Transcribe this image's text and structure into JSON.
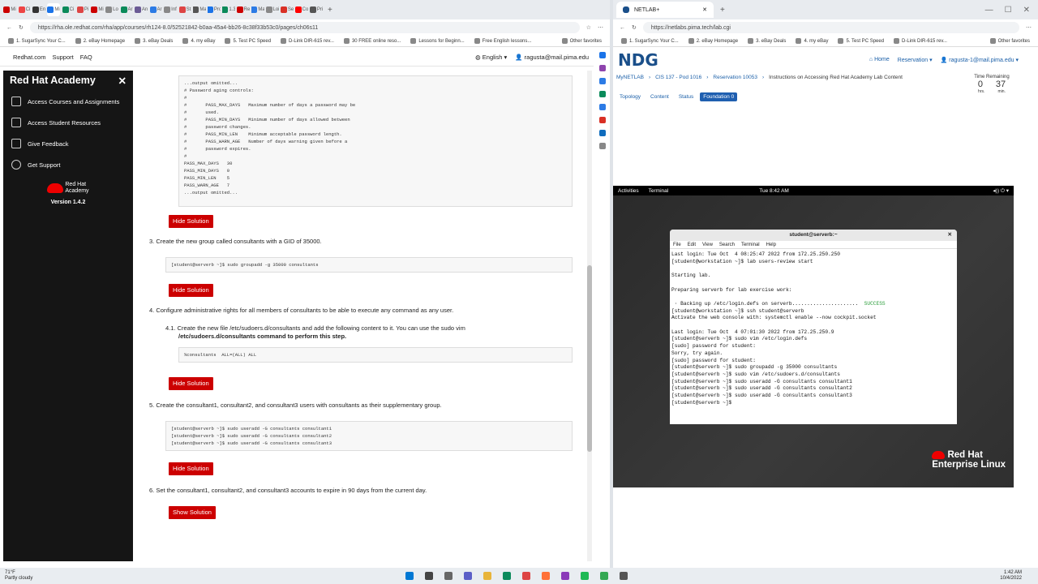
{
  "left_browser": {
    "tabs": [
      "Mi",
      "Ci",
      "En",
      "Mi",
      "Ci",
      "Pi",
      "Mi",
      "Lo",
      "Ar",
      "An",
      "Ar",
      "Inf",
      "St",
      "Ma",
      "Pro",
      "1.3",
      "Re",
      "Ma",
      "Loi",
      "Se",
      "Co",
      "Pri"
    ],
    "url": "https://rha.ole.redhat.com/rha/app/courses/rh124-8.0/52521842-b0aa-45a4-bb26-8c38f33b53c0/pages/ch06s11",
    "bookmarks": [
      "1. SugarSync Your C...",
      "2. eBay Homepage",
      "3. eBay Deals",
      "4. my eBay",
      "5. Test PC Speed",
      "D-Link DIR-615 rev...",
      "30 FREE online reso...",
      "Lessons for Beginn...",
      "Free English lessons...",
      "Other favorites"
    ],
    "topnav": {
      "links": [
        "Redhat.com",
        "Support",
        "FAQ"
      ],
      "language": "English",
      "user": "ragusta@mail.pima.edu"
    },
    "sidebar": {
      "title": "Red Hat Academy",
      "items": [
        "Access Courses and Assignments",
        "Access Student Resources",
        "Give Feedback",
        "Get Support"
      ],
      "logo_line1": "Red Hat",
      "logo_line2": "Academy",
      "version": "Version 1.4.2"
    },
    "content": {
      "code1": "...output omitted...\n# Password aging controls:\n#\n#       PASS_MAX_DAYS   Maximum number of days a password may be\n#       used.\n#       PASS_MIN_DAYS   Minimum number of days allowed between\n#       password changes.\n#       PASS_MIN_LEN    Minimum acceptable password length.\n#       PASS_WARN_AGE   Number of days warning given before a\n#       password expires.\n#\nPASS_MAX_DAYS   30\nPASS_MIN_DAYS   0\nPASS_MIN_LEN    5\nPASS_WARN_AGE   7\n...output omitted...",
      "hide_label": "Hide Solution",
      "show_label": "Show Solution",
      "step3": "3.  Create the new group called consultants with a GID of 35000.",
      "code3": "[student@serverb ~]$ sudo groupadd -g 35000 consultants",
      "step4": "4.  Configure administrative rights for all members of consultants to be able to execute any command as any user.",
      "step41a": "4.1.  Create the new file /etc/sudoers.d/consultants and add the following content to it. You can use the sudo vim",
      "step41b": "/etc/sudoers.d/consultants command to perform this step.",
      "code41": "%consultants  ALL=(ALL) ALL",
      "step5": "5.  Create the consultant1, consultant2, and consultant3 users with consultants as their supplementary group.",
      "code5": "[student@serverb ~]$ sudo useradd -G consultants consultant1\n[student@serverb ~]$ sudo useradd -G consultants consultant2\n[student@serverb ~]$ sudo useradd -G consultants consultant3",
      "step6": "6.  Set the consultant1, consultant2, and consultant3 accounts to expire in 90 days from the current day."
    }
  },
  "right_browser": {
    "tab_title": "NETLAB+",
    "url": "https://netlabs.pima.tech/lab.cgi",
    "bookmarks": [
      "1. SugarSync Your C...",
      "2. eBay Homepage",
      "3. eBay Deals",
      "4. my eBay",
      "5. Test PC Speed",
      "D-Link DIR-615 rev...",
      "Other favorites"
    ],
    "logo": "NDG",
    "nav": [
      "Home",
      "Reservation",
      "ragusta-1@mail.pima.edu"
    ],
    "breadcrumb": [
      "MyNETLAB",
      "CIS 137 - Pod 1016",
      "Reservation 10053",
      "Instructions on Accessing Red Hat Academy Lab Content"
    ],
    "time": {
      "label": "Time Remaining",
      "hrs": "0",
      "min": "37",
      "hrs_label": "hrs.",
      "min_label": "min."
    },
    "tabs": [
      "Topology",
      "Content",
      "Status",
      "Foundation 0"
    ],
    "vm": {
      "activities": "Activities",
      "app": "Terminal",
      "clock": "Tue 8:42 AM",
      "term_title": "student@serverb:~",
      "menu": [
        "File",
        "Edit",
        "View",
        "Search",
        "Terminal",
        "Help"
      ],
      "output_a": "Last login: Tue Oct  4 08:25:47 2022 from 172.25.250.250\n[student@workstation ~]$ lab users-review start\n\nStarting lab.\n\nPreparing serverb for lab exercise work:\n\n · Backing up /etc/login.defs on serverb......................",
      "success": "  SUCCESS",
      "output_b": "\n[student@workstation ~]$ ssh student@serverb\nActivate the web console with: systemctl enable --now cockpit.socket\n\nLast login: Tue Oct  4 07:01:30 2022 from 172.25.250.9\n[student@serverb ~]$ sudo vim /etc/login.defs\n[sudo] password for student:\nSorry, try again.\n[sudo] password for student:\n[student@serverb ~]$ sudo groupadd -g 35000 consultants\n[student@serverb ~]$ sudo vim /etc/sudoers.d/consultants\n[student@serverb ~]$ sudo useradd -G consultants consultant1\n[student@serverb ~]$ sudo useradd -G consultants consultant2\n[student@serverb ~]$ sudo useradd -G consultants consultant3\n[student@serverb ~]$ ",
      "rhel1": "Red Hat",
      "rhel2": "Enterprise Linux"
    }
  },
  "taskbar": {
    "weather_temp": "71°F",
    "weather_desc": "Partly cloudy",
    "time": "1:42 AM",
    "date": "10/4/2022"
  },
  "colors": {
    "redhat": "#cc0000",
    "ndg": "#1a4f8a",
    "netlab_tab": "#1f5fb0"
  }
}
